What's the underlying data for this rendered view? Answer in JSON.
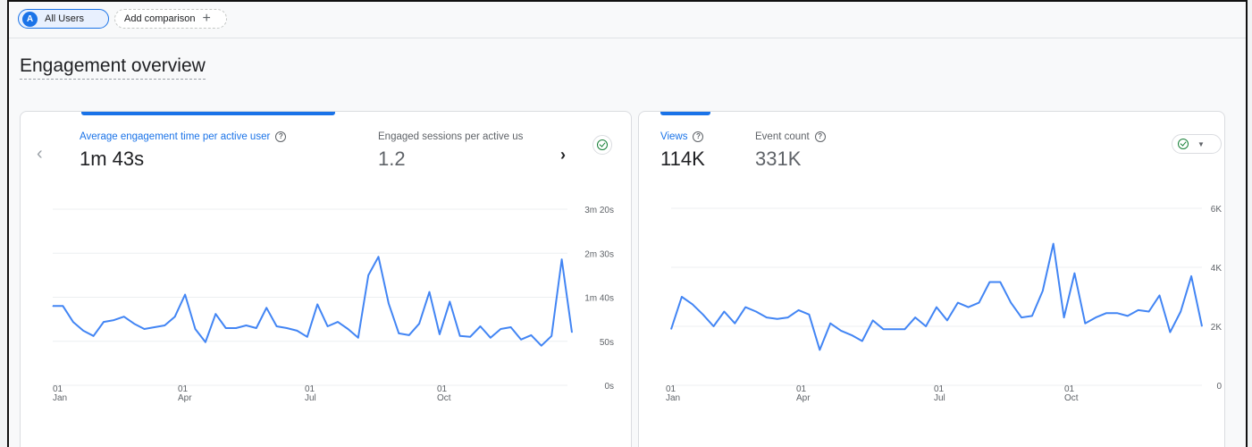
{
  "comparison_bar": {
    "segment_avatar": "A",
    "segment_label": "All Users",
    "add_comparison_label": "Add comparison",
    "add_icon": "plus-icon"
  },
  "section": {
    "title": "Engagement overview"
  },
  "left_card": {
    "metrics": [
      {
        "label": "Average engagement time per active user",
        "value": "1m 43s",
        "active": true
      },
      {
        "label": "Engaged sessions per active us",
        "value": "1.2",
        "active": false
      }
    ],
    "prev_icon": "chevron-left-icon",
    "next_icon": "chevron-right-icon",
    "status_icon": "check-circle-icon"
  },
  "right_card": {
    "metrics": [
      {
        "label": "Views",
        "value": "114K",
        "active": true
      },
      {
        "label": "Event count",
        "value": "331K",
        "active": false
      }
    ],
    "status_icon": "check-circle-icon",
    "dropdown_icon": "caret-down-icon"
  },
  "colors": {
    "accent": "#1a73e8",
    "line": "#4285f4",
    "success": "#188038"
  },
  "chart_data": [
    {
      "type": "line",
      "title": "",
      "series": [
        {
          "name": "Average engagement time per active user",
          "unit": "seconds",
          "values": [
            90,
            90,
            72,
            62,
            56,
            72,
            74,
            78,
            70,
            64,
            66,
            68,
            78,
            103,
            64,
            49,
            81,
            65,
            65,
            68,
            65,
            88,
            67,
            65,
            62,
            55,
            92,
            67,
            72,
            64,
            54,
            125,
            146,
            93,
            59,
            57,
            70,
            106,
            58,
            95,
            56,
            55,
            67,
            54,
            64,
            66,
            52,
            57,
            45,
            56,
            143,
            60
          ]
        }
      ],
      "x_tick_labels": [
        [
          "01",
          "Jan"
        ],
        [
          "01",
          "Apr"
        ],
        [
          "01",
          "Jul"
        ],
        [
          "01",
          "Oct"
        ]
      ],
      "y_tick_labels": [
        "3m 20s",
        "2m 30s",
        "1m 40s",
        "50s",
        "0s"
      ],
      "ylim": [
        0,
        200
      ],
      "grid": true
    },
    {
      "type": "line",
      "title": "",
      "series": [
        {
          "name": "Views",
          "values": [
            1900,
            3000,
            2750,
            2400,
            2000,
            2500,
            2100,
            2650,
            2500,
            2300,
            2250,
            2300,
            2550,
            2400,
            1200,
            2100,
            1850,
            1700,
            1500,
            2200,
            1900,
            1900,
            1900,
            2300,
            2000,
            2650,
            2200,
            2800,
            2650,
            2800,
            3500,
            3500,
            2800,
            2300,
            2350,
            3200,
            4800,
            2300,
            3800,
            2100,
            2300,
            2450,
            2450,
            2350,
            2550,
            2500,
            3050,
            1800,
            2500,
            3700,
            2000
          ]
        }
      ],
      "x_tick_labels": [
        [
          "01",
          "Jan"
        ],
        [
          "01",
          "Apr"
        ],
        [
          "01",
          "Jul"
        ],
        [
          "01",
          "Oct"
        ]
      ],
      "y_tick_labels": [
        "6K",
        "4K",
        "2K",
        "0"
      ],
      "ylim": [
        0,
        6000
      ],
      "grid": true
    }
  ]
}
